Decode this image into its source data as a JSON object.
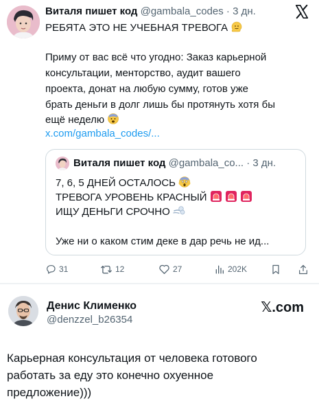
{
  "tweet": {
    "author_name": "Виталя пишет код",
    "author_handle": "@gambala_codes",
    "separator": "·",
    "time": "3 дн.",
    "lines": [
      "РЕБЯТА ЭТО НЕ УЧЕБНАЯ ТРЕВОГА",
      "",
      "Приму от вас всё что угодно: Заказ карьерной",
      "консультации, менторство, аудит вашего",
      "проекта, донат на любую сумму, готов уже",
      "брать деньги в долг лишь бы протянуть хотя бы",
      "ещё неделю"
    ],
    "link_text": "x.com/gambala_codes/...",
    "icons": [
      "x-logo-icon",
      "melting-face-icon",
      "fearful-face-icon"
    ],
    "quote": {
      "author_name": "Виталя пишет код",
      "author_handle": "@gambala_co...",
      "separator": "·",
      "time": "3 дн.",
      "lines": [
        "7, 6, 5 ДНЕЙ ОСТАЛОСЬ",
        "ТРЕВОГА УРОВЕНЬ КРАСНЫЙ",
        "ИЩУ ДЕНЬГИ СРОЧНО",
        "",
        "Уже ни о каком стим деке в дар речь не ид..."
      ],
      "icons": [
        "screaming-face-icon",
        "siren-icon",
        "dash-icon"
      ]
    },
    "actions": {
      "replies": "31",
      "reposts": "12",
      "likes": "27",
      "views": "202K"
    }
  },
  "reply": {
    "author_name": "Денис Клименко",
    "author_handle": "@denzzel_b26354",
    "brand": "𝕏.com",
    "lines": [
      "Карьерная консультация от человека готового",
      "работать за еду это конечно охуенное",
      "предложение)))"
    ]
  },
  "colors": {
    "text": "#0f1419",
    "muted": "#536471",
    "link": "#1d9bf0",
    "border": "#cfd9de",
    "siren_red": "#e0245e"
  }
}
